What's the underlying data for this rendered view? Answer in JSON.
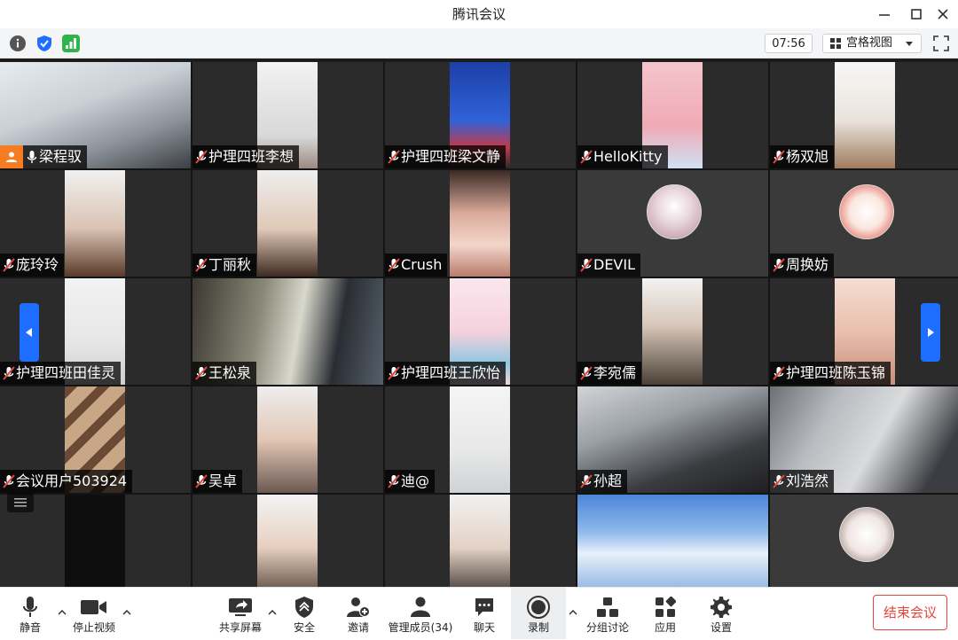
{
  "window": {
    "title": "腾讯会议"
  },
  "infobar": {
    "timer": "07:56",
    "view_label": "宫格视图"
  },
  "participants": [
    {
      "name": "梁程驭"
    },
    {
      "name": "护理四班李想"
    },
    {
      "name": "护理四班梁文静"
    },
    {
      "name": "HelloKitty"
    },
    {
      "name": "杨双旭"
    },
    {
      "name": "庞玲玲"
    },
    {
      "name": "丁丽秋"
    },
    {
      "name": "Crush"
    },
    {
      "name": "DEVIL"
    },
    {
      "name": "周换妨"
    },
    {
      "name": "护理四班田佳灵"
    },
    {
      "name": "王松泉"
    },
    {
      "name": "护理四班王欣怡"
    },
    {
      "name": "李宛儒"
    },
    {
      "name": "护理四班陈玉锦"
    },
    {
      "name": "会议用户503924"
    },
    {
      "name": "吴卓"
    },
    {
      "name": "迪@"
    },
    {
      "name": "孙超"
    },
    {
      "name": "刘浩然"
    }
  ],
  "toolbar": {
    "mute": "静音",
    "stop_video": "停止视频",
    "share_screen": "共享屏幕",
    "security": "安全",
    "invite": "邀请",
    "members": "管理成员(34)",
    "chat": "聊天",
    "record": "录制",
    "breakout": "分组讨论",
    "apps": "应用",
    "settings": "设置",
    "end_meeting": "结束会议"
  },
  "colors": {
    "accent": "#1e6fff",
    "danger": "#e5463c",
    "host": "#f57c20"
  }
}
